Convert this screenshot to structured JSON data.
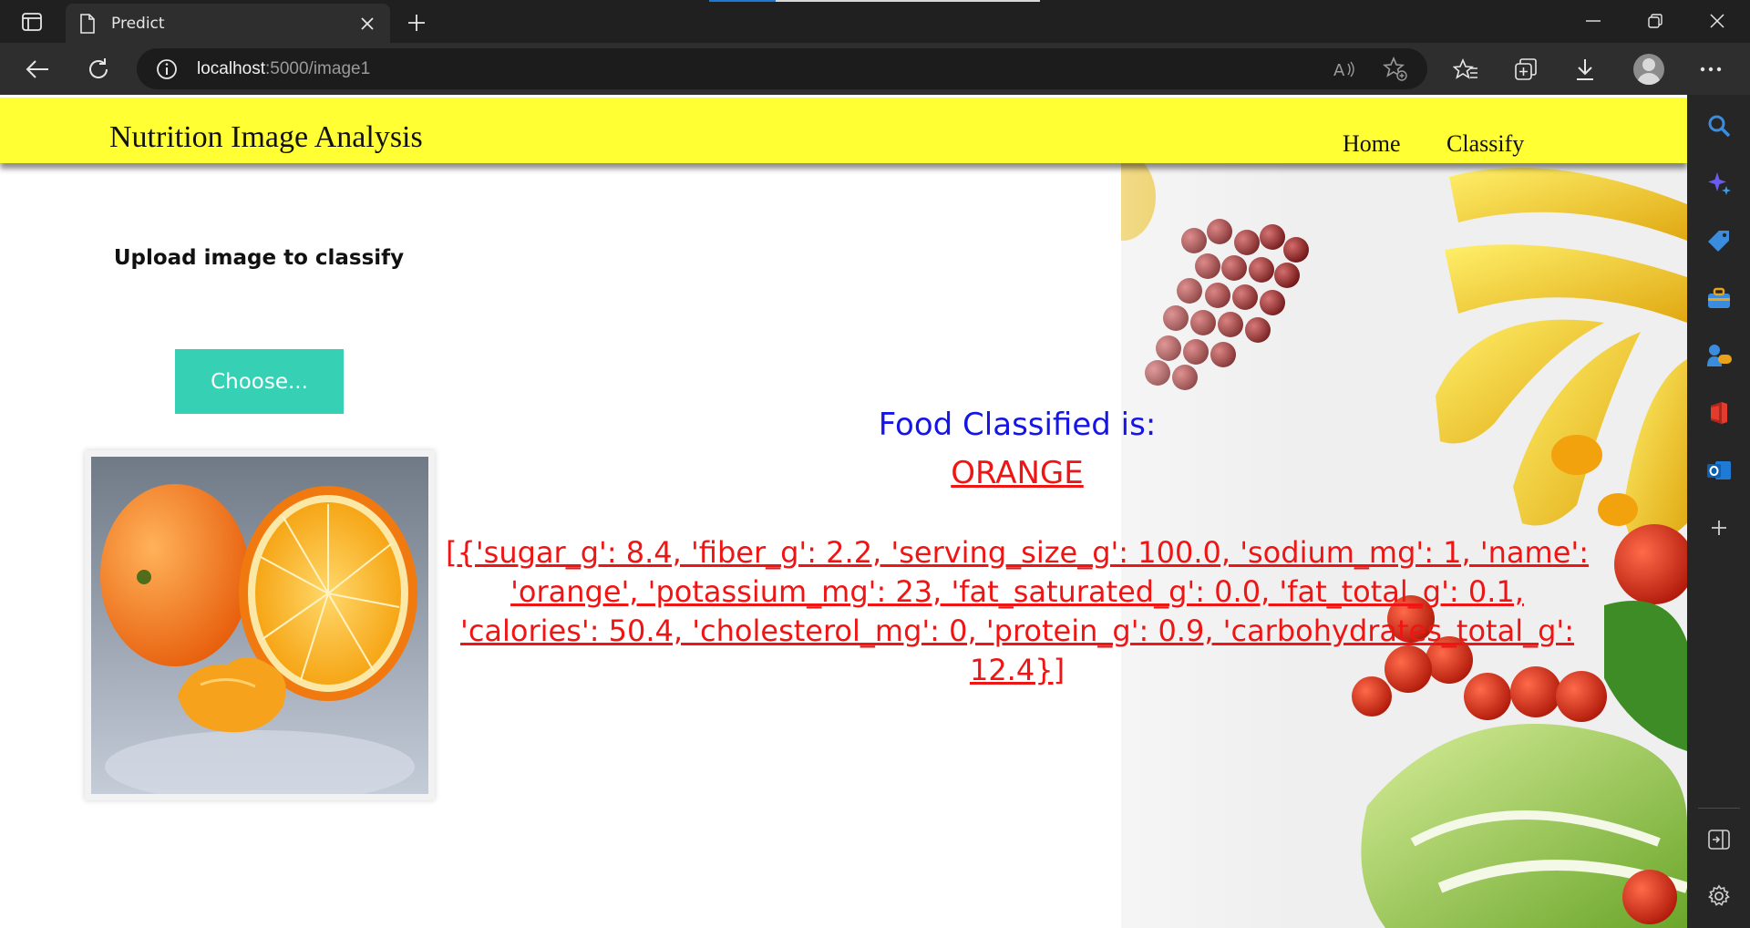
{
  "browser": {
    "tab_title": "Predict",
    "url_host": "localhost",
    "url_path": ":5000/image1",
    "load_progress": 0.2
  },
  "site": {
    "title": "Nutrition Image Analysis",
    "nav": [
      "Home",
      "Classify"
    ],
    "header_color": "#ffff33"
  },
  "upload": {
    "heading": "Upload image to classify",
    "button_label": "Choose..."
  },
  "result": {
    "label": "Food Classified is:",
    "food": "ORANGE",
    "nutrition": "[{'sugar_g': 8.4, 'fiber_g': 2.2, 'serving_size_g': 100.0, 'sodium_mg': 1, 'name': 'orange', 'potassium_mg': 23, 'fat_saturated_g': 0.0, 'fat_total_g': 0.1, 'calories': 50.4, 'cholesterol_mg': 0, 'protein_g': 0.9, 'carbohydrates_total_g': 12.4}]"
  },
  "icons": {
    "sidebar": [
      "search-icon",
      "copilot-icon",
      "shopping-tag-icon",
      "tools-icon",
      "games-icon",
      "office-icon",
      "outlook-icon",
      "add-icon",
      "sidebar-collapse-icon",
      "settings-icon"
    ]
  },
  "colors": {
    "accent_button": "#36d1b5",
    "result_label": "#1515e6",
    "result_value": "#ee1515"
  }
}
